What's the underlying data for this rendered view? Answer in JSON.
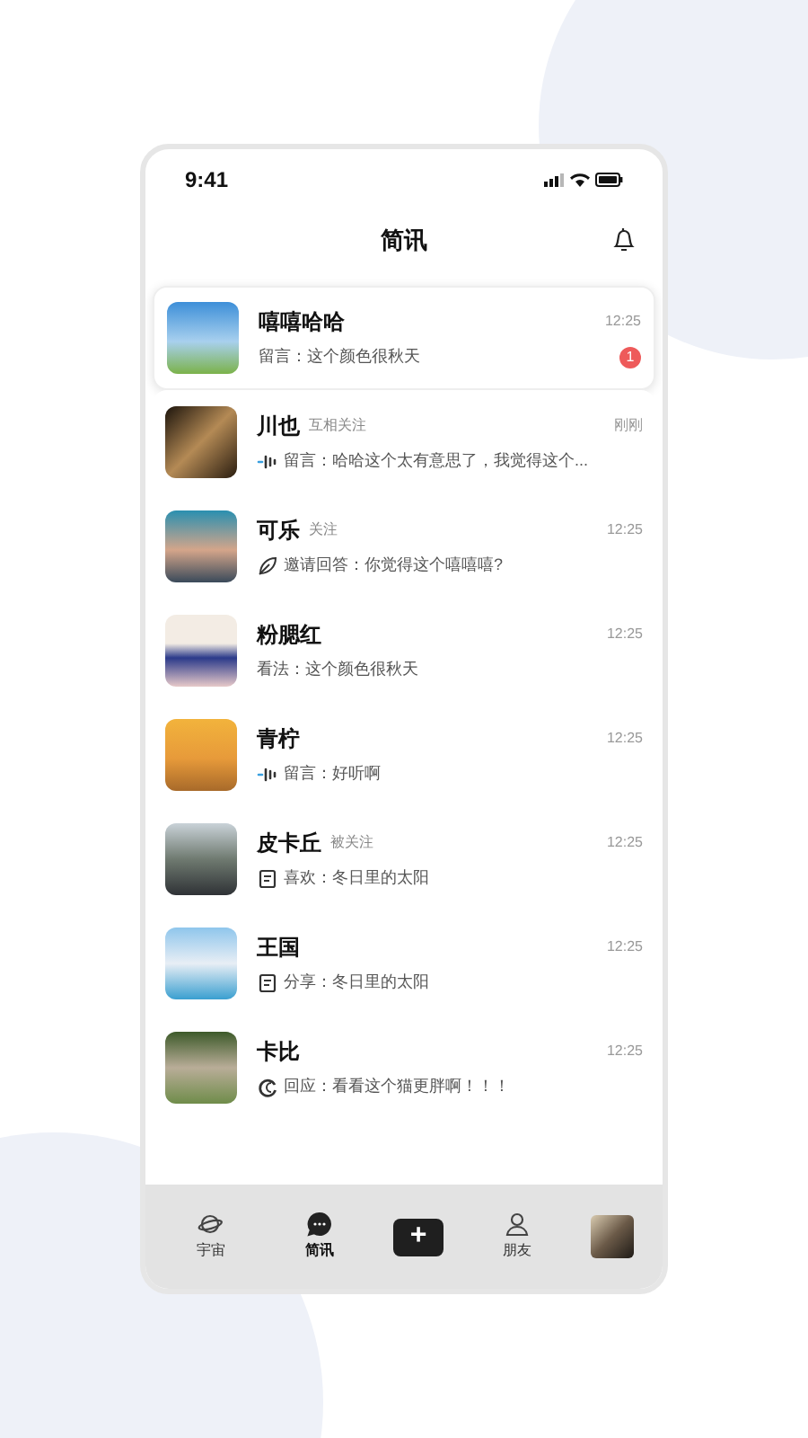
{
  "status_bar": {
    "time": "9:41"
  },
  "header": {
    "title": "简讯"
  },
  "messages": [
    {
      "name": "嘻嘻哈哈",
      "time": "12:25",
      "kind": "plain",
      "preview": "留言：这个颜色很秋天",
      "unread": "1",
      "selected": true
    },
    {
      "name": "川也",
      "tag": "互相关注",
      "time": "刚刚",
      "kind": "voice",
      "preview": "留言：哈哈这个太有意思了，我觉得这个...",
      "selected": false
    },
    {
      "name": "可乐",
      "tag": "关注",
      "time": "12:25",
      "kind": "pen",
      "preview": "邀请回答：你觉得这个嘻嘻嘻?",
      "selected": false
    },
    {
      "name": "粉腮红",
      "time": "12:25",
      "kind": "plain",
      "preview": "看法：这个颜色很秋天",
      "selected": false
    },
    {
      "name": "青柠",
      "time": "12:25",
      "kind": "voice",
      "preview": "留言：好听啊",
      "selected": false
    },
    {
      "name": "皮卡丘",
      "tag": "被关注",
      "time": "12:25",
      "kind": "doc",
      "preview": "喜欢：冬日里的太阳",
      "selected": false
    },
    {
      "name": "王国",
      "time": "12:25",
      "kind": "doc",
      "preview": "分享：冬日里的太阳",
      "selected": false
    },
    {
      "name": "卡比",
      "time": "12:25",
      "kind": "loop",
      "preview": "回应：看看这个猫更胖啊！！！",
      "selected": false
    }
  ],
  "tab_bar": [
    {
      "kind": "planet",
      "label": "宇宙",
      "selected": false
    },
    {
      "kind": "chat",
      "label": "简讯",
      "selected": true
    },
    {
      "kind": "plus",
      "label": "+",
      "selected": false
    },
    {
      "kind": "person",
      "label": "朋友",
      "selected": false
    },
    {
      "kind": "avatar",
      "selected": false
    }
  ]
}
